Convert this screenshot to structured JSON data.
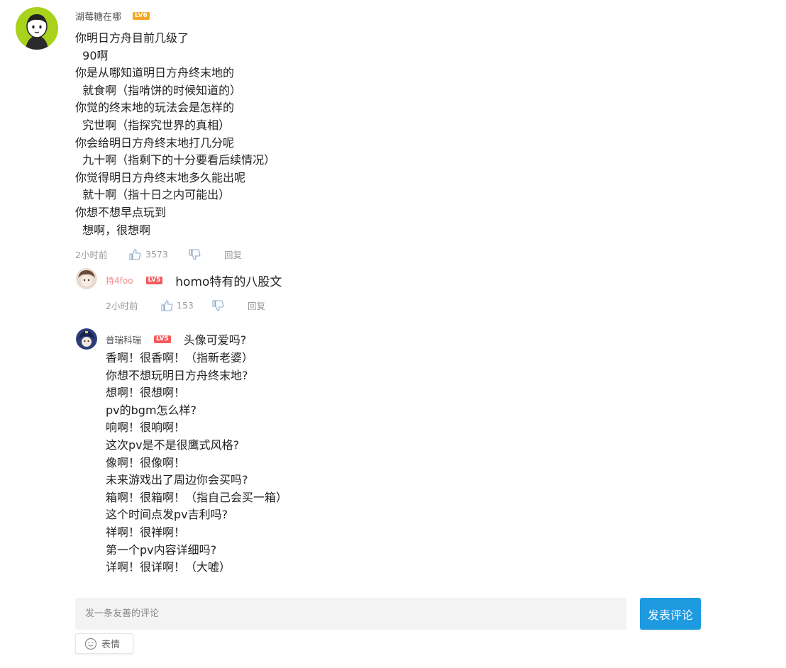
{
  "comment": {
    "username": "湖莓糖在哪",
    "badge": "LV6",
    "lines": [
      "你明日方舟目前几级了",
      "  90啊",
      "你是从哪知道明日方舟终末地的",
      "  就食啊（指啃饼的时候知道的）",
      "你觉的终末地的玩法会是怎样的",
      "  究世啊（指探究世界的真相）",
      "你会给明日方舟终末地打几分呢",
      "  九十啊（指剩下的十分要看后续情况）",
      "你觉得明日方舟终末地多久能出呢",
      "  就十啊（指十日之内可能出）",
      "你想不想早点玩到",
      "  想啊，很想啊"
    ],
    "time": "2小时前",
    "likes": "3573",
    "reply_label": "回复"
  },
  "replies": [
    {
      "username": "持4foo",
      "badge": "LV5",
      "text": "homo特有的八股文",
      "time": "2小时前",
      "likes": "153",
      "reply_label": "回复"
    },
    {
      "username": "普瑞科瑞",
      "badge": "LV5",
      "first_line": "头像可爱吗?",
      "lines": [
        "香啊！很香啊！（指新老婆）",
        "你想不想玩明日方舟终末地?",
        "想啊！很想啊！",
        "pv的bgm怎么样?",
        "响啊！很响啊！",
        "这次pv是不是很鹰式风格?",
        "像啊！很像啊！",
        "未来游戏出了周边你会买吗?",
        "箱啊！很箱啊！（指自己会买一箱）",
        "这个时间点发pv吉利吗?",
        "祥啊！很祥啊！",
        "第一个pv内容详细吗?",
        "详啊！很详啊！（大嘘）"
      ]
    }
  ],
  "composer": {
    "placeholder": "发一条友善的评论",
    "submit_label": "发表评论",
    "emoji_label": "表情"
  },
  "colors": {
    "accent": "#1d9ae0",
    "avatar_main": "#a8d21c",
    "badge_lv6": "#f5a623",
    "badge_lv5": "#f45a5a",
    "reply_name": "#f08a8a"
  }
}
